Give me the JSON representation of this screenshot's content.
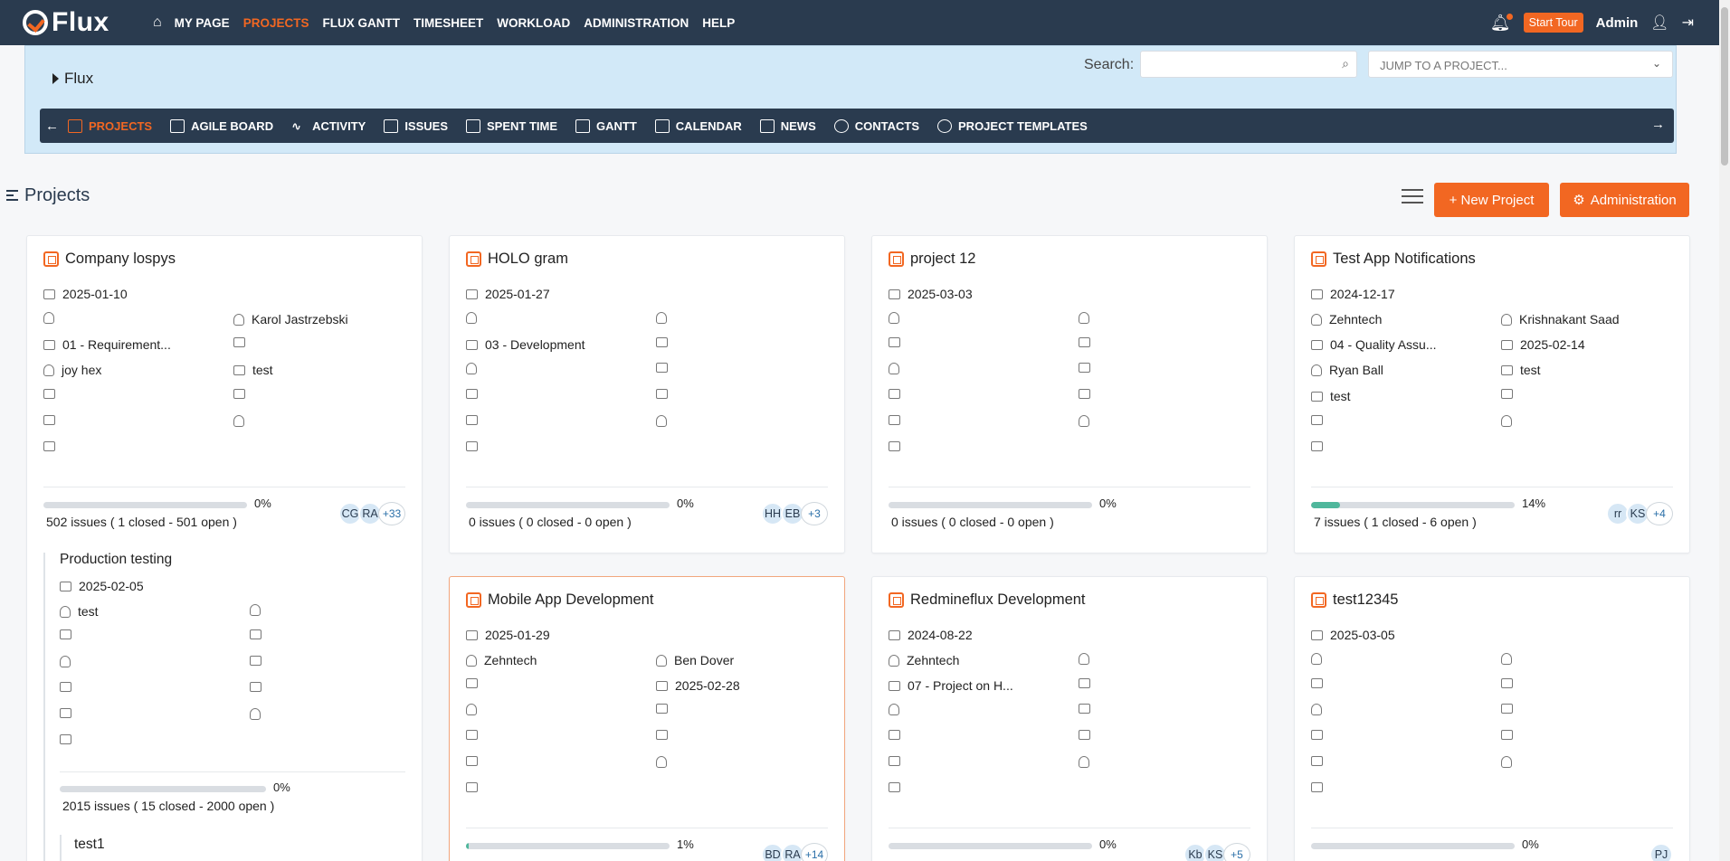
{
  "app": {
    "logo": "Flux"
  },
  "topnav": {
    "items": [
      "MY PAGE",
      "PROJECTS",
      "FLUX GANTT",
      "TIMESHEET",
      "WORKLOAD",
      "ADMINISTRATION",
      "HELP"
    ],
    "active": "PROJECTS",
    "start_tour": "Start Tour",
    "user": "Admin"
  },
  "header": {
    "breadcrumb": "Flux",
    "search_label": "Search:",
    "search_value": "",
    "jump_placeholder": "JUMP TO A PROJECT..."
  },
  "subnav": {
    "items": [
      "PROJECTS",
      "AGILE BOARD",
      "ACTIVITY",
      "ISSUES",
      "SPENT TIME",
      "GANTT",
      "CALENDAR",
      "NEWS",
      "CONTACTS",
      "PROJECT TEMPLATES"
    ],
    "active": "PROJECTS"
  },
  "page": {
    "title": "Projects",
    "new_project": "+ New Project",
    "administration": "Administration"
  },
  "colors": {
    "accent": "#f26722",
    "nav_bg": "#2a3b4f",
    "header_bg": "#d2e9f8",
    "progress": "#4fb79c"
  },
  "cards": [
    {
      "title": "Company lospys",
      "start": "2025-01-10",
      "owner": "",
      "manager": "Karol Jastrzebski",
      "stage": "01 - Requirement...",
      "due": "",
      "lead": "joy hex",
      "client": "test",
      "platform": "",
      "percent": "0%",
      "progress": 0,
      "issues": "502 issues ( 1 closed - 501 open )",
      "avatars": [
        "CG",
        "RA"
      ],
      "more": "+33",
      "subproject": {
        "title": "Production testing",
        "start": "2025-02-05",
        "owner": "test",
        "percent": "0%",
        "progress": 0,
        "issues": "2015 issues ( 15 closed - 2000 open )",
        "child": "test1"
      }
    },
    {
      "title": "HOLO gram",
      "start": "2025-01-27",
      "owner": "",
      "manager": "",
      "stage": "03 - Development",
      "due": "",
      "lead": "",
      "client": "",
      "platform": "",
      "percent": "0%",
      "progress": 0,
      "issues": "0 issues ( 0 closed - 0 open )",
      "avatars": [
        "HH",
        "EB"
      ],
      "more": "+3"
    },
    {
      "title": "project 12",
      "start": "2025-03-03",
      "owner": "",
      "manager": "",
      "stage": "",
      "due": "",
      "lead": "",
      "client": "",
      "platform": "",
      "percent": "0%",
      "progress": 0,
      "issues": "0 issues ( 0 closed - 0 open )",
      "avatars": [],
      "more": ""
    },
    {
      "title": "Test App Notifications",
      "start": "2024-12-17",
      "owner": "Zehntech",
      "manager": "Krishnakant Saad",
      "stage": "04 - Quality Assu...",
      "due": "2025-02-14",
      "lead": "Ryan Ball",
      "client": "test",
      "platform": "test",
      "percent": "14%",
      "progress": 0.14,
      "issues": "7 issues ( 1 closed - 6 open )",
      "avatars": [
        "rr",
        "KS"
      ],
      "more": "+4"
    },
    {
      "title": "Mobile App Development",
      "start": "2025-01-29",
      "owner": "Zehntech",
      "manager": "Ben Dover",
      "stage": "",
      "due": "2025-02-28",
      "lead": "",
      "client": "",
      "platform": "",
      "percent": "1%",
      "progress": 0.01,
      "issues": "",
      "avatars": [
        "BD",
        "RA"
      ],
      "more": "+14"
    },
    {
      "title": "Redmineflux Development",
      "start": "2024-08-22",
      "owner": "Zehntech",
      "manager": "",
      "stage": "07 - Project on H...",
      "due": "",
      "lead": "",
      "client": "",
      "platform": "",
      "percent": "0%",
      "progress": 0,
      "issues": "",
      "avatars": [
        "Kb",
        "KS"
      ],
      "more": "+5"
    },
    {
      "title": "test12345",
      "start": "2025-03-05",
      "owner": "",
      "manager": "",
      "stage": "",
      "due": "",
      "lead": "",
      "client": "",
      "platform": "",
      "percent": "0%",
      "progress": 0,
      "issues": "",
      "avatars": [
        "PJ"
      ],
      "more": ""
    }
  ]
}
